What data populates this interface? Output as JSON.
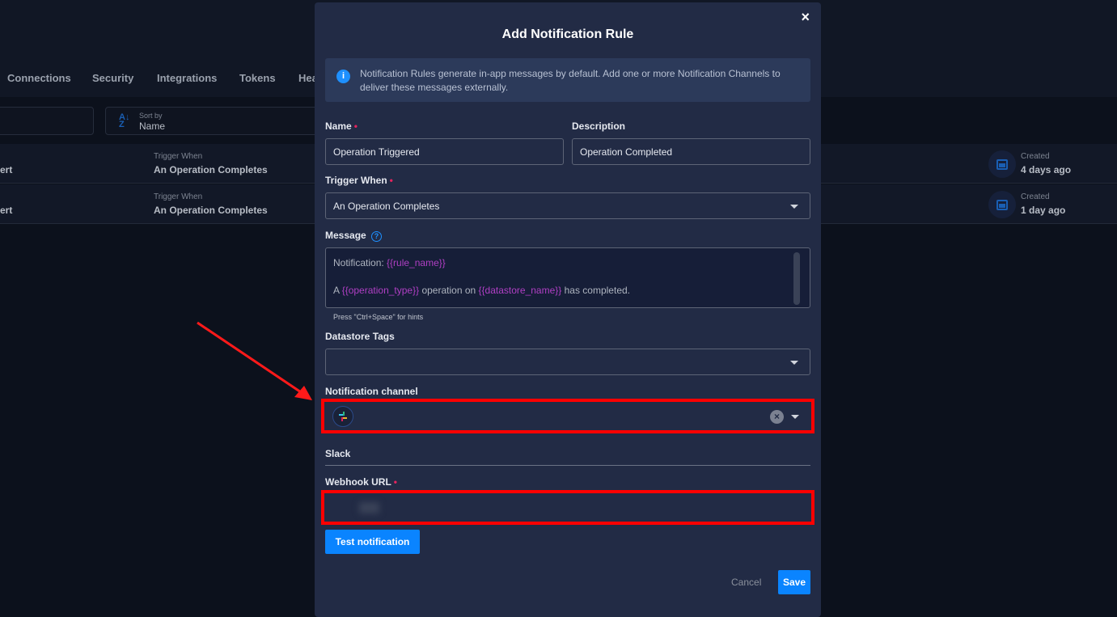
{
  "background": {
    "tabs": [
      "Connections",
      "Security",
      "Integrations",
      "Tokens",
      "Hea"
    ],
    "sort": {
      "label": "Sort by",
      "value": "Name"
    },
    "rows": [
      {
        "name_fragment": "ert",
        "trigger_label": "Trigger When",
        "trigger": "An Operation Completes",
        "created_label": "Created",
        "created": "4 days ago"
      },
      {
        "name_fragment": "ert",
        "trigger_label": "Trigger When",
        "trigger": "An Operation Completes",
        "created_label": "Created",
        "created": "1 day ago"
      }
    ]
  },
  "modal": {
    "title": "Add Notification Rule",
    "close": "×",
    "info": "Notification Rules generate in-app messages by default. Add one or more Notification Channels to deliver these messages externally.",
    "name": {
      "label": "Name",
      "required": "•",
      "value": "Operation Triggered"
    },
    "description": {
      "label": "Description",
      "value": "Operation Completed"
    },
    "trigger": {
      "label": "Trigger When",
      "required": "•",
      "value": "An Operation Completes"
    },
    "message": {
      "label": "Message",
      "line1_text": "Notification: ",
      "line1_var": "{{rule_name}}",
      "line2_a": "A ",
      "line2_var1": "{{operation_type}}",
      "line2_b": " operation on ",
      "line2_var2": "{{datastore_name}}",
      "line2_c": " has completed.",
      "hint": "Press \"Ctrl+Space\" for hints"
    },
    "datastore_tags": {
      "label": "Datastore Tags",
      "value": ""
    },
    "channel": {
      "label": "Notification channel",
      "icon": "slack-icon"
    },
    "slack_section": "Slack",
    "webhook": {
      "label": "Webhook URL",
      "required": "•",
      "value": ""
    },
    "test_button": "Test notification",
    "cancel": "Cancel",
    "save": "Save"
  },
  "colors": {
    "accent": "#0a84ff",
    "highlight": "#ff0000",
    "variable": "#b03fc4",
    "required": "#e5245e"
  }
}
